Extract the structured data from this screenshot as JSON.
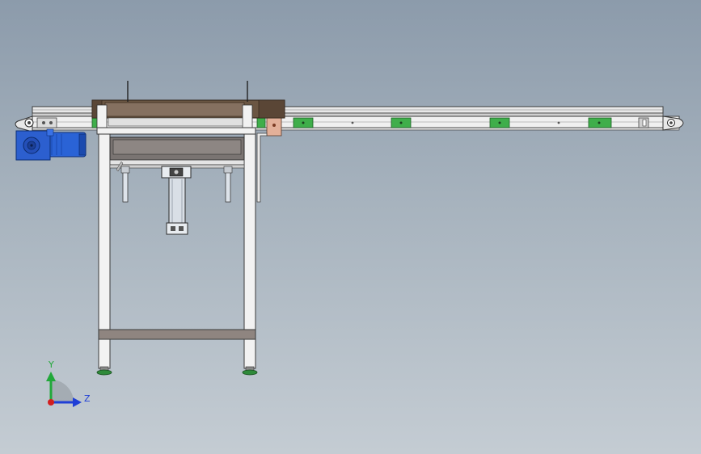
{
  "viewport": {
    "background_top": "#8c9bab",
    "background_bottom": "#c4ccd3"
  },
  "triad": {
    "y_label": "Y",
    "z_label": "Z",
    "y_color": "#22a83a",
    "z_color": "#1f3fd6",
    "x_color": "#d21f1f"
  },
  "colors": {
    "frame": "#f2f2f2",
    "frame_edge": "#3a3a3a",
    "belt": "#e6e6e6",
    "guide_block": "#3fae4a",
    "motor": "#2a63d6",
    "crossbar": "#8f8580",
    "brown_panel": "#6b5643",
    "feet": "#2f8a3a",
    "bracket": "#e0a890"
  }
}
